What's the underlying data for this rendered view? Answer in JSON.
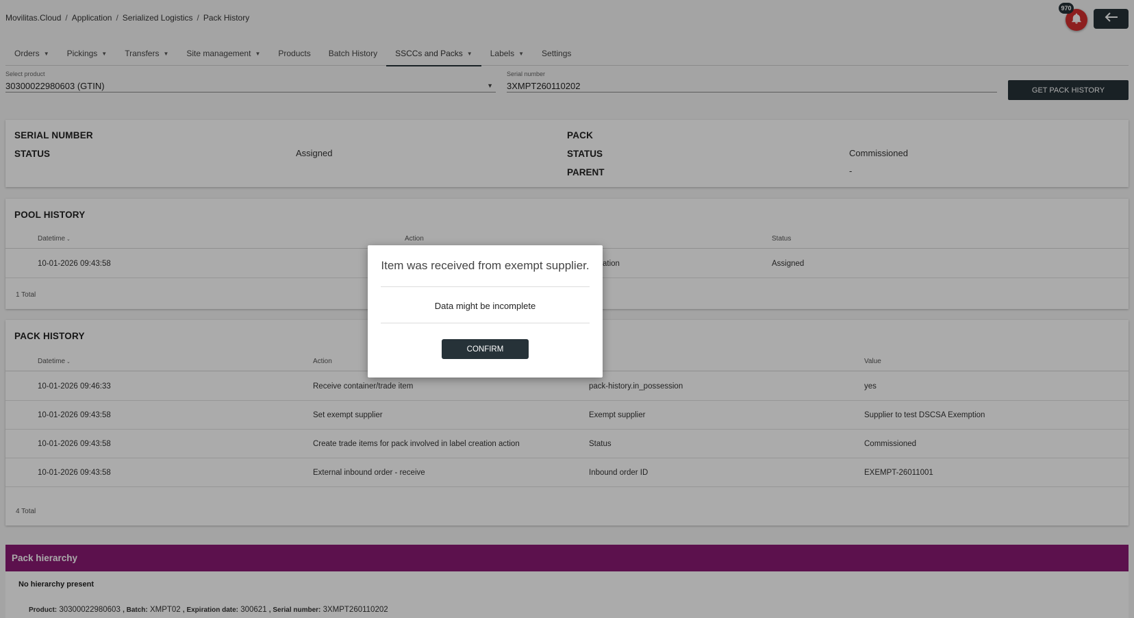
{
  "breadcrumb": [
    "Movilitas.Cloud",
    "Application",
    "Serialized Logistics",
    "Pack History"
  ],
  "header": {
    "notification_count": "970",
    "bell_icon": "bell-icon",
    "back_icon": "arrow-left-icon"
  },
  "tabs": [
    {
      "label": "Orders",
      "dropdown": true
    },
    {
      "label": "Pickings",
      "dropdown": true
    },
    {
      "label": "Transfers",
      "dropdown": true
    },
    {
      "label": "Site management",
      "dropdown": true
    },
    {
      "label": "Products",
      "dropdown": false
    },
    {
      "label": "Batch History",
      "dropdown": false
    },
    {
      "label": "SSCCs and Packs",
      "dropdown": true,
      "active": true
    },
    {
      "label": "Labels",
      "dropdown": true
    },
    {
      "label": "Settings",
      "dropdown": false
    }
  ],
  "form": {
    "product_label": "Select product",
    "product_value": "30300022980603 (GTIN)",
    "serial_label": "Serial number",
    "serial_value": "3XMPT260110202",
    "get_button": "GET PACK HISTORY"
  },
  "summary": {
    "serial_title": "SERIAL NUMBER",
    "serial_status_label": "STATUS",
    "serial_status_value": "Assigned",
    "pack_title": "PACK",
    "pack_status_label": "STATUS",
    "pack_status_value": "Commissioned",
    "pack_parent_label": "PARENT",
    "pack_parent_value": "-"
  },
  "pool_history": {
    "title": "POOL HISTORY",
    "columns": [
      "Datetime",
      "Action",
      "Status"
    ],
    "rows": [
      {
        "datetime": "10-01-2026 09:43:58",
        "action": "ation",
        "status": "Assigned"
      }
    ],
    "total": "1 Total"
  },
  "pack_history": {
    "title": "PACK HISTORY",
    "columns": [
      "Datetime",
      "Action",
      "",
      "Value"
    ],
    "rows": [
      {
        "datetime": "10-01-2026 09:46:33",
        "action": "Receive container/trade item",
        "field": "pack-history.in_possession",
        "value": "yes"
      },
      {
        "datetime": "10-01-2026 09:43:58",
        "action": "Set exempt supplier",
        "field": "Exempt supplier",
        "value": "Supplier to test DSCSA Exemption"
      },
      {
        "datetime": "10-01-2026 09:43:58",
        "action": "Create trade items for pack involved in label creation action",
        "field": "Status",
        "value": "Commissioned"
      },
      {
        "datetime": "10-01-2026 09:43:58",
        "action": "External inbound order - receive",
        "field": "Inbound order ID",
        "value": "EXEMPT-26011001"
      }
    ],
    "total": "4 Total"
  },
  "hierarchy": {
    "title": "Pack hierarchy",
    "empty_text": "No hierarchy present",
    "product_label": "Product:",
    "product_value": "30300022980603",
    "batch_label": ", Batch:",
    "batch_value": "XMPT02",
    "expiry_label": ", Expiration date:",
    "expiry_value": "300621",
    "serial_label": ", Serial number:",
    "serial_value": "3XMPT260110202"
  },
  "dialog": {
    "title": "Item was received from exempt supplier.",
    "message": "Data might be incomplete",
    "confirm": "CONFIRM"
  },
  "colors": {
    "primary": "#263238",
    "hierarchy_header": "#8a1a74",
    "notification": "#d32f2f"
  }
}
